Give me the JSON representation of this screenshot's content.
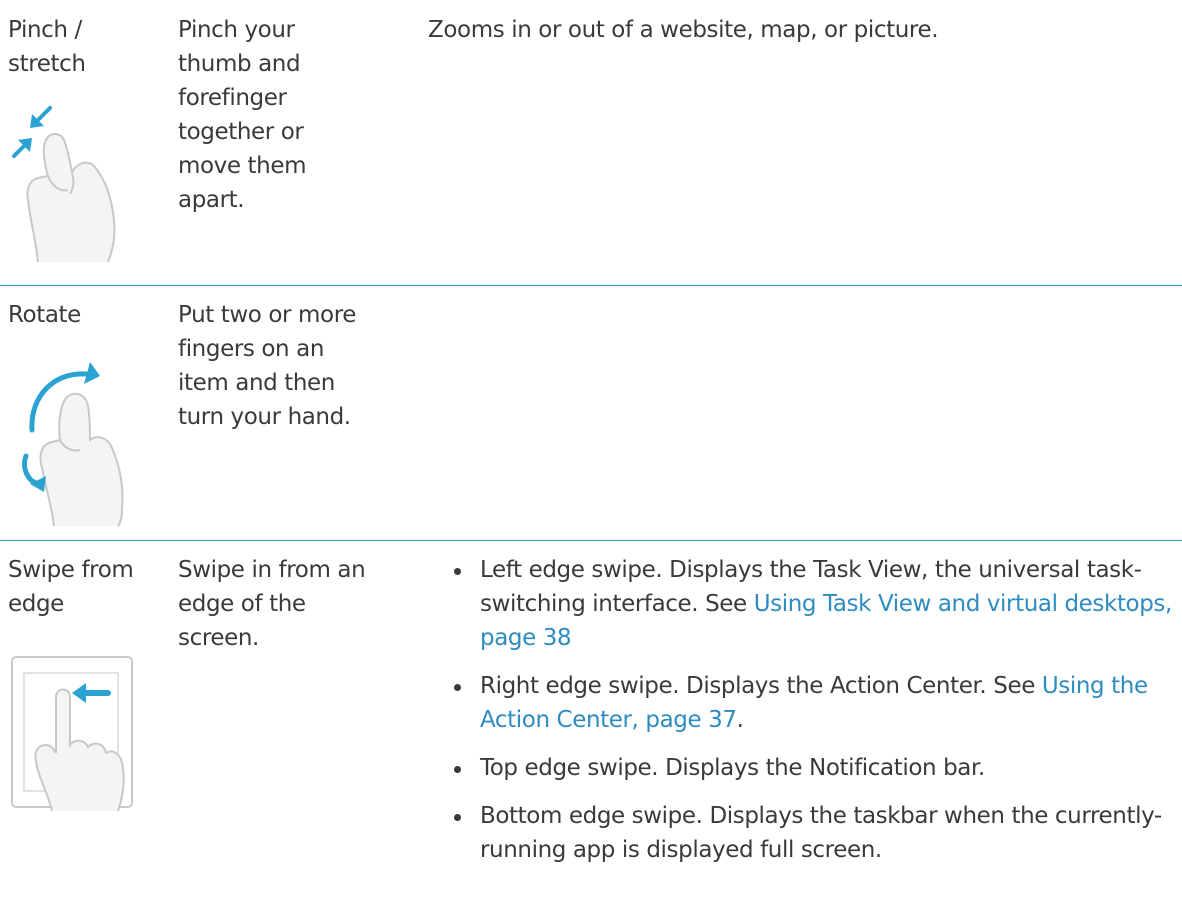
{
  "rows": [
    {
      "gesture": "Pinch / stretch",
      "how": "Pinch your thumb and forefinger together or move them apart.",
      "result": "Zooms in or out of a website, map, or picture.",
      "icon": "pinch-hand-icon"
    },
    {
      "gesture": "Rotate",
      "how": "Put two or more fingers on an item and then turn your hand.",
      "result": "",
      "icon": "rotate-hand-icon"
    },
    {
      "gesture": "Swipe from edge",
      "how": "Swipe in from an edge of the screen.",
      "icon": "edge-swipe-hand-icon",
      "results": [
        {
          "text": "Left edge swipe. Displays the Task View, the universal task-switching interface. See ",
          "link": "Using Task View and virtual desktops, page 38",
          "after": ""
        },
        {
          "text": "Right edge swipe. Displays the Action Center. See ",
          "link": "Using the Action Center, page 37",
          "after": "."
        },
        {
          "text": "Top edge swipe. Displays the Notification bar.",
          "link": "",
          "after": ""
        },
        {
          "text": "Bottom edge swipe. Displays the taskbar when the currently-running app is displayed full screen.",
          "link": "",
          "after": ""
        }
      ]
    }
  ],
  "colors": {
    "divider": "#3c9cc4",
    "icon_accent": "#2aa3d2",
    "link": "#2e8cc0",
    "text": "#3a3a3a"
  }
}
